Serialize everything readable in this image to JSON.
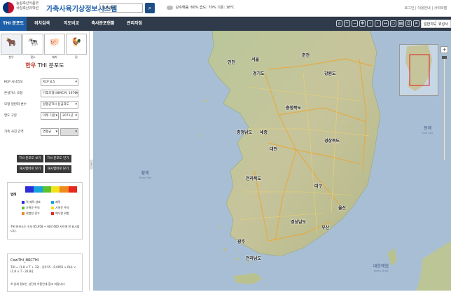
{
  "header": {
    "org_line1": "농림축산식품부",
    "org_line2": "국립축산과학원",
    "system_title": "가축사육기상정보시스템",
    "search_placeholder": "행정검색",
    "weather": {
      "humidity_label": "강수확률:",
      "humidity_value": "60%",
      "humidity2_label": "습도:",
      "humidity2_value": "70%",
      "temp_label": "기온:",
      "temp_value": "18℃"
    },
    "top_links": "로그인 | 이용안내 | 사이트맵"
  },
  "nav": {
    "tabs": [
      {
        "label": "THI 분포도",
        "active": true
      },
      {
        "label": "위치검색",
        "active": false
      },
      {
        "label": "지도비교",
        "active": false
      },
      {
        "label": "축사분포현황",
        "active": false
      },
      {
        "label": "관리자정",
        "active": false
      }
    ],
    "tool_icons": [
      "home-icon",
      "zoom-in-icon",
      "zoom-out-icon",
      "pan-icon",
      "back-icon",
      "forward-icon",
      "measure-distance-icon",
      "measure-area-icon",
      "save-icon",
      "print-icon",
      "clear-icon"
    ],
    "right_buttons": [
      "일반지도",
      "위성사진"
    ]
  },
  "sidebar": {
    "animals": [
      {
        "label": "한우",
        "icon": "cow-icon",
        "active": true
      },
      {
        "label": "젖소",
        "icon": "dairy-cow-icon",
        "active": false
      },
      {
        "label": "돼지",
        "icon": "pig-icon",
        "active": false
      },
      {
        "label": "닭",
        "icon": "chicken-icon",
        "active": false
      }
    ],
    "title_prefix": "한우",
    "title_main": "THI 분포도",
    "filters": [
      {
        "label": "RCP 시나리오",
        "value": "RCP 8.5"
      },
      {
        "label": "온실가스 모형",
        "value": "기후모형(INMCM, 1970)"
      },
      {
        "label": "모형 일반화 변수",
        "value": "일평균THI 등급과도"
      },
      {
        "label": "연도 구분",
        "value1": "미래 기준",
        "value2": "2071년"
      },
      {
        "label": "가축 사진 간격",
        "value1": "연평균",
        "value2": ""
      }
    ],
    "buttons": [
      "THI 분포도 보기",
      "THI 분포도 닫기",
      "해시맵바로 보기",
      "해시맵바로 닫기"
    ],
    "legend": {
      "colors": [
        "#2d2dd8",
        "#17a2e0",
        "#5cc12e",
        "#f4e21a",
        "#f08a1d",
        "#e8271e"
      ],
      "key": "범례",
      "items": [
        {
          "color": "#2d2dd8",
          "text": "적 쾌적 양호"
        },
        {
          "color": "#17a2e0",
          "text": "쾌적"
        },
        {
          "color": "#5cc12e",
          "text": "가벼운 주의"
        },
        {
          "color": "#f4e21a",
          "text": "가벼운 주의"
        },
        {
          "color": "#f08a1d",
          "text": "위험한 경고"
        },
        {
          "color": "#e8271e",
          "text": "매우한 위험"
        }
      ],
      "note": "THI 분포도는 숫자 85,958 ~ 687,600 사이에 한 표시합니다."
    },
    "formula": {
      "title": "CowTHI_NRCTHI",
      "expression": "THI = (1.8 × T + 32) - [(0.55 - 0.0055 × RH) × (1.8 × T - 26.8)]",
      "note": "※ 상세 정보는 상단의 이용안내 참고 바랍니다."
    }
  },
  "map": {
    "seas": [
      {
        "name": "황해",
        "sub": "Yellow Sea"
      },
      {
        "name": "동해",
        "sub": "East Sea"
      },
      {
        "name": "대한해협",
        "sub": "Korea Strait"
      }
    ],
    "cities": [
      "인천",
      "서울",
      "춘천",
      "강원도",
      "충청북도",
      "세종",
      "대전",
      "충청남도",
      "전라북도",
      "경상북도",
      "대구",
      "울산",
      "부산",
      "광주",
      "전라남도",
      "경상남도",
      "경기도"
    ]
  }
}
